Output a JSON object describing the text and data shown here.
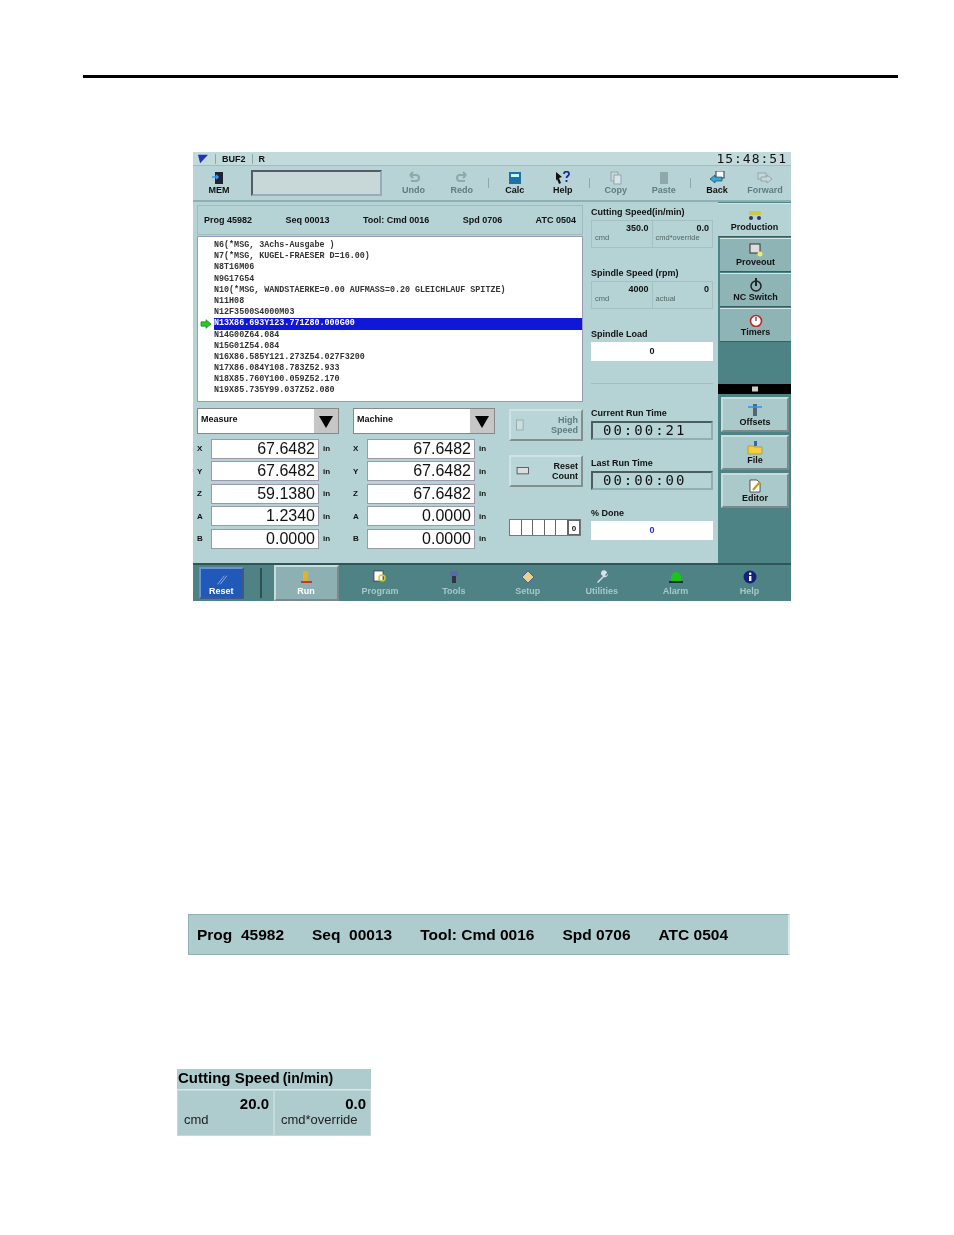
{
  "screen": {
    "title_bar": {
      "mode": "BUF2",
      "flag": "R",
      "clock": "15:48:51"
    },
    "toolbar": [
      {
        "label": "MEM",
        "disabled": false
      },
      {
        "label": "Undo",
        "disabled": true
      },
      {
        "label": "Redo",
        "disabled": true
      },
      {
        "label": "Calc",
        "disabled": false
      },
      {
        "label": "Help",
        "disabled": false
      },
      {
        "label": "Copy",
        "disabled": true
      },
      {
        "label": "Paste",
        "disabled": true
      },
      {
        "label": "Back",
        "disabled": false
      },
      {
        "label": "Forward",
        "disabled": true
      }
    ],
    "status": [
      "Prog 45982",
      "Seq 00013",
      "Tool: Cmd 0016",
      "Spd 0706",
      "ATC 0504"
    ],
    "program": [
      {
        "text": "N6(*MSG, 3Achs-Ausgabe )",
        "selected": false
      },
      {
        "text": "N7(*MSG, KUGEL-FRAESER D=16.00)",
        "selected": false
      },
      {
        "text": "N8T16M06",
        "selected": false
      },
      {
        "text": "N9G17G54",
        "selected": false
      },
      {
        "text": "N10(*MSG, WANDSTAERKE=0.00 AUFMASS=0.20 GLEICHLAUF SPITZE)",
        "selected": false
      },
      {
        "text": "N11H08",
        "selected": false
      },
      {
        "text": "N12F3500S4000M03",
        "selected": false
      },
      {
        "text": "N13X86.693Y123.771Z80.000G00",
        "selected": true
      },
      {
        "text": "N14G00Z64.084",
        "selected": false
      },
      {
        "text": "N15G01Z54.084",
        "selected": false
      },
      {
        "text": "N16X86.585Y121.273Z54.027F3200",
        "selected": false
      },
      {
        "text": "N17X86.084Y108.783Z52.933",
        "selected": false
      },
      {
        "text": "N18X85.760Y100.059Z52.170",
        "selected": false
      },
      {
        "text": "N19X85.735Y99.037Z52.080",
        "selected": false
      }
    ],
    "positions": [
      {
        "mode": "Measure",
        "axes": [
          {
            "axis": "X",
            "value": "67.6482",
            "unit": "in"
          },
          {
            "axis": "Y",
            "value": "67.6482",
            "unit": "in"
          },
          {
            "axis": "Z",
            "value": "59.1380",
            "unit": "in"
          },
          {
            "axis": "A",
            "value": "1.2340",
            "unit": "in"
          },
          {
            "axis": "B",
            "value": "0.0000",
            "unit": "in"
          }
        ]
      },
      {
        "mode": "Machine",
        "axes": [
          {
            "axis": "X",
            "value": "67.6482",
            "unit": "in"
          },
          {
            "axis": "Y",
            "value": "67.6482",
            "unit": "in"
          },
          {
            "axis": "Z",
            "value": "67.6482",
            "unit": "in"
          },
          {
            "axis": "A",
            "value": "0.0000",
            "unit": "in"
          },
          {
            "axis": "B",
            "value": "0.0000",
            "unit": "in"
          }
        ]
      }
    ],
    "buttons": [
      {
        "label": "High Speed",
        "disabled": true
      },
      {
        "label": "Reset Count",
        "disabled": false
      }
    ],
    "counter": "0",
    "cutting_speed": {
      "title": "Cutting Speed(in/min)",
      "cells": [
        {
          "value": "350.0",
          "caption": "cmd"
        },
        {
          "value": "0.0",
          "caption": "cmd*override"
        }
      ]
    },
    "spindle_speed": {
      "title": "Spindle Speed  (rpm)",
      "cells": [
        {
          "value": "4000",
          "caption": "cmd"
        },
        {
          "value": "0",
          "caption": "actual"
        }
      ]
    },
    "spindle_load": {
      "title": "Spindle Load",
      "value": "0"
    },
    "current_run_time": {
      "title": "Current Run Time",
      "value": "00:00:21"
    },
    "last_run_time": {
      "title": "Last Run Time",
      "value": "00:00:00"
    },
    "percent_done": {
      "title": "% Done",
      "value": "0"
    },
    "side_tabs": [
      {
        "label": "Production",
        "selected": true
      },
      {
        "label": "Proveout",
        "selected": false
      },
      {
        "label": "NC Switch",
        "selected": false
      },
      {
        "label": "Timers",
        "selected": false
      }
    ],
    "side_buttons": [
      "Offsets",
      "File",
      "Editor"
    ],
    "reset_button": "Reset",
    "nav": [
      {
        "label": "Run",
        "selected": true
      },
      {
        "label": "Program",
        "selected": false
      },
      {
        "label": "Tools",
        "selected": false
      },
      {
        "label": "Setup",
        "selected": false
      },
      {
        "label": "Utilities",
        "selected": false
      },
      {
        "label": "Alarm",
        "selected": false
      },
      {
        "label": "Help",
        "selected": false
      }
    ]
  },
  "detail_status": [
    "Prog  45982",
    "Seq  00013",
    "Tool: Cmd 0016",
    "Spd 0706",
    "ATC 0504"
  ],
  "detail_cutting_speed": {
    "title": "Cutting Speed",
    "unit": "(in/min)",
    "cells": [
      {
        "value": "20.0",
        "caption": "cmd"
      },
      {
        "value": "0.0",
        "caption": "cmd*override"
      }
    ]
  }
}
